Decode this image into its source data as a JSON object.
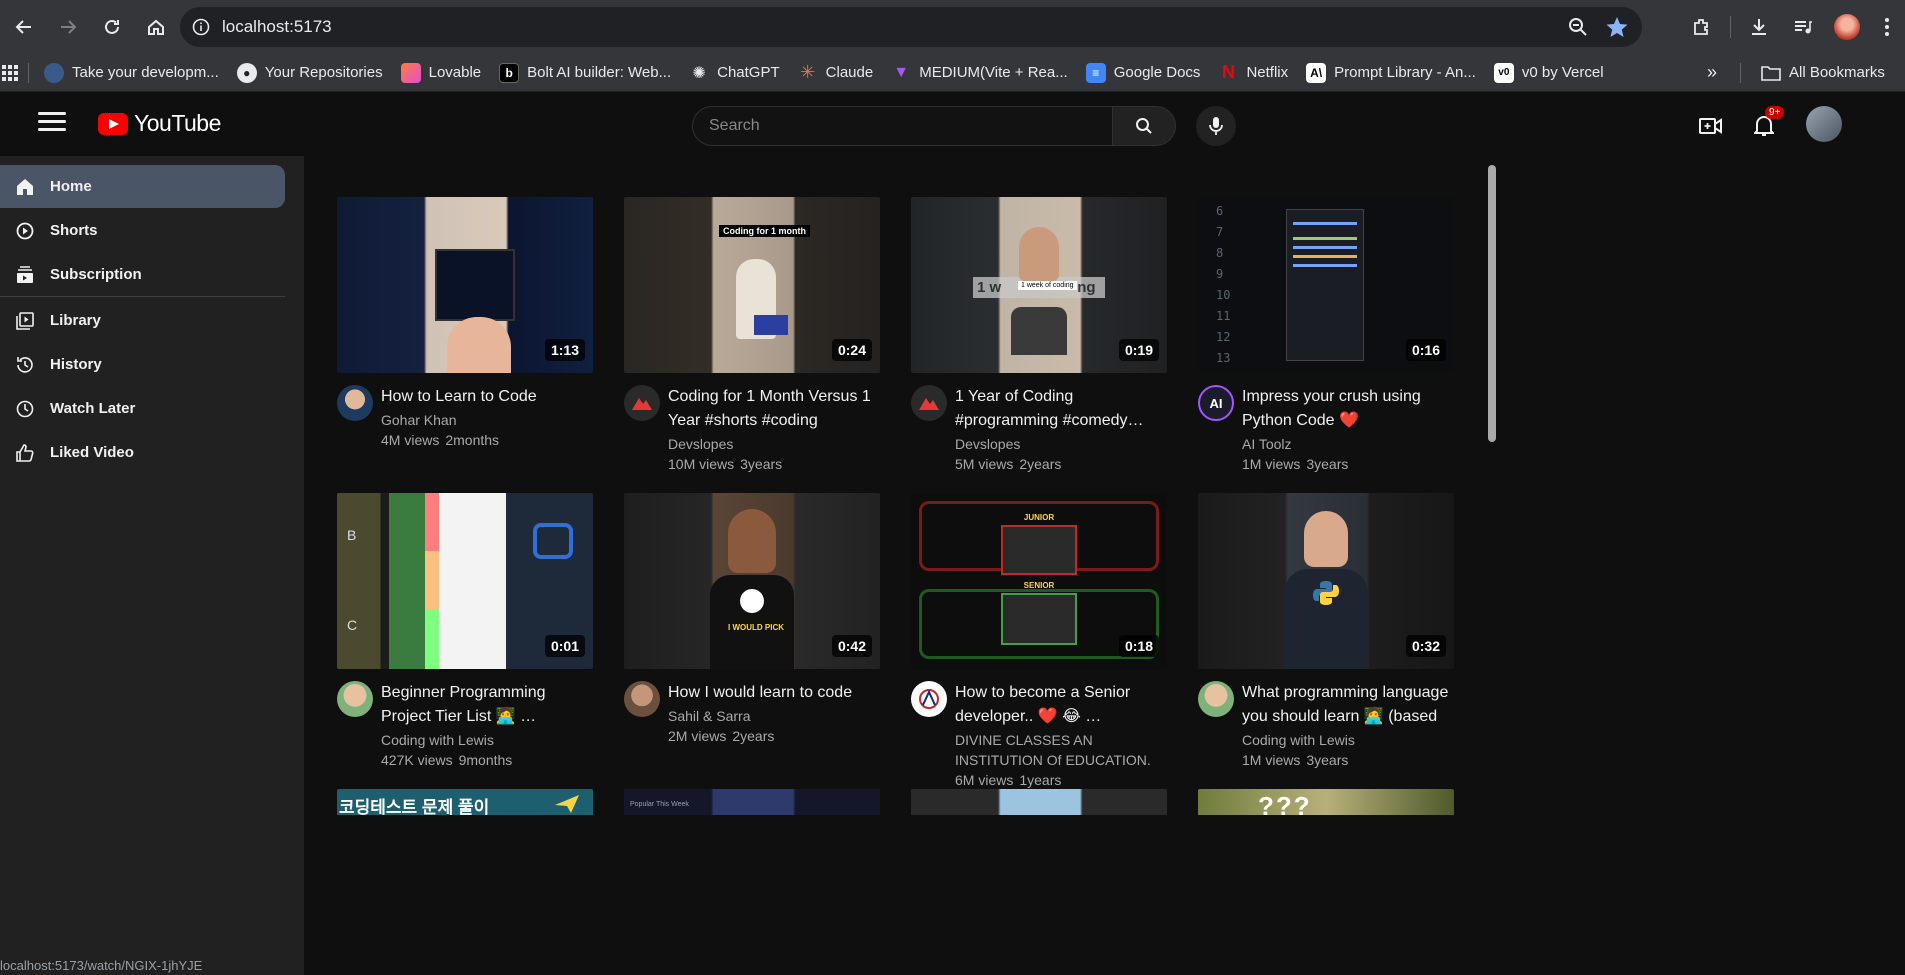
{
  "browser": {
    "url": "localhost:5173",
    "status_url": "localhost:5173/watch/NGIX-1jhYJE",
    "bookmarks": [
      {
        "label": "Take your developm...",
        "icon": "avatar-bookmark-icon"
      },
      {
        "label": "Your Repositories",
        "icon": "github-icon"
      },
      {
        "label": "Lovable",
        "icon": "lovable-icon"
      },
      {
        "label": "Bolt AI builder: Web...",
        "icon": "bolt-icon"
      },
      {
        "label": "ChatGPT",
        "icon": "chatgpt-icon"
      },
      {
        "label": "Claude",
        "icon": "claude-icon"
      },
      {
        "label": "MEDIUM(Vite + Rea...",
        "icon": "vite-icon"
      },
      {
        "label": "Google Docs",
        "icon": "google-docs-icon"
      },
      {
        "label": "Netflix",
        "icon": "netflix-icon"
      },
      {
        "label": "Prompt Library - An...",
        "icon": "anthropic-icon"
      },
      {
        "label": "v0 by Vercel",
        "icon": "v0-icon"
      }
    ],
    "all_bookmarks": "All Bookmarks"
  },
  "header": {
    "logo_text": "YouTube",
    "search_placeholder": "Search",
    "notification_count": "9+"
  },
  "sidebar": {
    "items": [
      {
        "label": "Home",
        "icon": "home-icon",
        "active": true
      },
      {
        "label": "Shorts",
        "icon": "shorts-icon",
        "active": false
      },
      {
        "label": "Subscription",
        "icon": "subscriptions-icon",
        "active": false
      },
      {
        "label": "Library",
        "icon": "library-icon",
        "active": false
      },
      {
        "label": "History",
        "icon": "history-icon",
        "active": false
      },
      {
        "label": "Watch Later",
        "icon": "clock-icon",
        "active": false
      },
      {
        "label": "Liked Video",
        "icon": "thumbs-up-icon",
        "active": false
      }
    ]
  },
  "videos": [
    {
      "title": "How to Learn to Code",
      "channel": "Gohar Khan",
      "views": "4M views",
      "age": "2months",
      "duration": "1:13"
    },
    {
      "title": "Coding for 1 Month Versus 1 Year #shorts #coding",
      "channel": "Devslopes",
      "views": "10M views",
      "age": "3years",
      "duration": "0:24",
      "thumb_caption": "Coding for 1 month"
    },
    {
      "title": "1 Year of Coding #programming #comedy…",
      "channel": "Devslopes",
      "views": "5M views",
      "age": "2years",
      "duration": "0:19",
      "thumb_caption": "1 week of coding"
    },
    {
      "title": "Impress your crush using Python Code ❤️",
      "channel": "AI Toolz",
      "views": "1M views",
      "age": "3years",
      "duration": "0:16"
    },
    {
      "title": "Beginner Programming Project Tier List 🧑‍💻 …",
      "channel": "Coding with Lewis",
      "views": "427K views",
      "age": "9months",
      "duration": "0:01"
    },
    {
      "title": "How I would learn to code",
      "channel": "Sahil & Sarra",
      "views": "2M views",
      "age": "2years",
      "duration": "0:42",
      "thumb_caption": "I WOULD PICK"
    },
    {
      "title": "How to become a Senior developer.. ❤️ 😂 …",
      "channel": "DIVINE CLASSES AN INSTITUTION Of EDUCATION.",
      "views": "6M views",
      "age": "1years",
      "duration": "0:18",
      "thumb_caption_top": "JUNIOR",
      "thumb_caption_bottom": "SENIOR"
    },
    {
      "title": "What programming language you should learn 🧑‍💻 (based o…",
      "channel": "Coding with Lewis",
      "views": "1M views",
      "age": "3years",
      "duration": "0:32"
    }
  ],
  "partial_row": {
    "first_thumb_text": "코딩테스트 문제 풀이",
    "second_thumb_text": "Popular This Week"
  },
  "colors": {
    "background": "#0f0f0f",
    "sidebar": "#212121",
    "active_item": "#4a5568",
    "brand_red": "#ff0000"
  }
}
